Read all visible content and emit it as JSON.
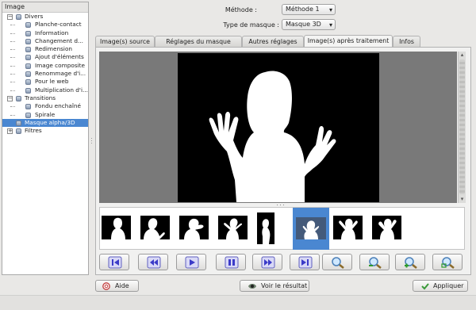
{
  "tree": {
    "header": "Image",
    "items": [
      {
        "label": "Divers",
        "level": 0,
        "expander": "−"
      },
      {
        "label": "Planche-contact",
        "level": 1
      },
      {
        "label": "Information",
        "level": 1
      },
      {
        "label": "Changement d...",
        "level": 1
      },
      {
        "label": "Redimension",
        "level": 1
      },
      {
        "label": "Ajout d'éléments",
        "level": 1
      },
      {
        "label": "Image composite",
        "level": 1
      },
      {
        "label": "Renommage d'i...",
        "level": 1
      },
      {
        "label": "Pour le web",
        "level": 1
      },
      {
        "label": "Multiplication d'i...",
        "level": 1
      },
      {
        "label": "Transitions",
        "level": 0,
        "expander": "−"
      },
      {
        "label": "Fondu enchaîné",
        "level": 1
      },
      {
        "label": "Spirale",
        "level": 1
      },
      {
        "label": "Masque alpha/3D",
        "level": 0,
        "selected": true
      },
      {
        "label": "Filtres",
        "level": 0,
        "expander": "+"
      }
    ]
  },
  "controls": {
    "method_label": "Méthode :",
    "method_value": "Méthode 1",
    "mask_label": "Type de masque :",
    "mask_value": "Masque 3D"
  },
  "tabs": [
    {
      "label": "Image(s) source"
    },
    {
      "label": "Réglages du masque"
    },
    {
      "label": "Autres réglages"
    },
    {
      "label": "Image(s) après traitement",
      "active": true
    },
    {
      "label": "Infos"
    }
  ],
  "thumbnails_count": 8,
  "selected_thumbnail": 5,
  "nav_buttons": [
    {
      "icon": "first-frame-icon"
    },
    {
      "icon": "previous-frame-icon"
    },
    {
      "icon": "play-icon"
    },
    {
      "icon": "pause-icon"
    },
    {
      "icon": "next-frame-icon"
    },
    {
      "icon": "last-frame-icon"
    },
    {
      "icon": "zoom-icon"
    },
    {
      "icon": "zoom-out-icon"
    },
    {
      "icon": "zoom-in-icon"
    },
    {
      "icon": "zoom-fit-icon"
    }
  ],
  "buttons": {
    "help": "Aide",
    "view_result": "Voir le résultat",
    "apply": "Appliquer"
  },
  "colors": {
    "accent": "#4a87d1",
    "nav_icon": "#3b3bc8",
    "preview_bg": "#797979"
  }
}
